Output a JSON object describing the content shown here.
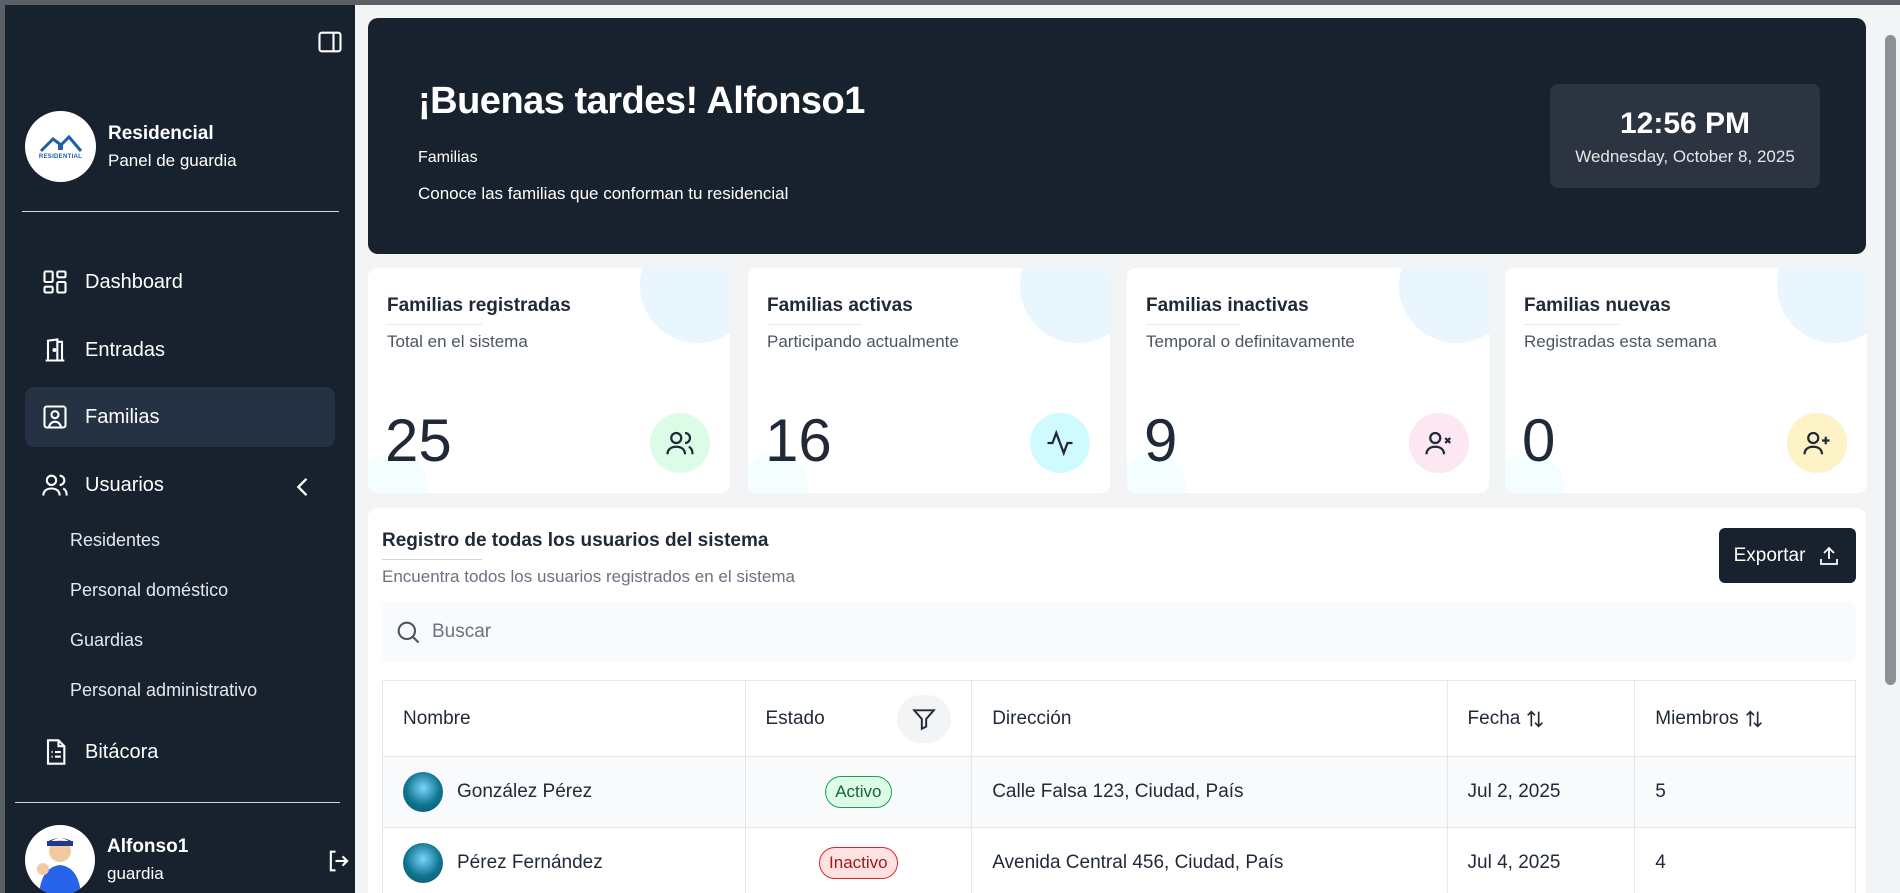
{
  "sidebar": {
    "brand": {
      "title": "Residencial",
      "subtitle": "Panel de guardia",
      "logo_text": "RESIDENTIAL"
    },
    "nav": [
      {
        "label": "Dashboard",
        "icon": "dashboard-icon"
      },
      {
        "label": "Entradas",
        "icon": "door-icon"
      },
      {
        "label": "Familias",
        "icon": "contact-card-icon",
        "active": true
      },
      {
        "label": "Usuarios",
        "icon": "users-icon"
      }
    ],
    "sub_items": [
      "Residentes",
      "Personal doméstico",
      "Guardias",
      "Personal administrativo"
    ],
    "bitacora": "Bitácora",
    "user": {
      "name": "Alfonso1",
      "role": "guardia"
    }
  },
  "hero": {
    "title": "¡Buenas tardes! Alfonso1",
    "subtitle": "Familias",
    "description": "Conoce las familias que conforman tu residencial",
    "time": "12:56 PM",
    "date": "Wednesday, October 8, 2025"
  },
  "stats": [
    {
      "title": "Familias registradas",
      "desc": "Total en el sistema",
      "value": "25",
      "color": "#dcfce7",
      "blob": "#dbeafe"
    },
    {
      "title": "Familias activas",
      "desc": "Participando actualmente",
      "value": "16",
      "color": "#cffafe",
      "blob": "#dbeafe"
    },
    {
      "title": "Familias inactivas",
      "desc": "Temporal o definitavamente",
      "value": "9",
      "color": "#fce7f3",
      "blob": "#dbeafe"
    },
    {
      "title": "Familias nuevas",
      "desc": "Registradas esta semana",
      "value": "0",
      "color": "#fef3c7",
      "blob": "#dbeafe"
    }
  ],
  "table_card": {
    "title": "Registro de todas los usuarios del sistema",
    "description": "Encuentra todos los usuarios registrados en el sistema",
    "export_label": "Exportar",
    "search_placeholder": "Buscar",
    "columns": [
      "Nombre",
      "Estado",
      "Dirección",
      "Fecha",
      "Miembros"
    ],
    "rows": [
      {
        "name": "González Pérez",
        "status": "Activo",
        "address": "Calle Falsa 123, Ciudad, País",
        "date": "Jul 2, 2025",
        "members": "5"
      },
      {
        "name": "Pérez Fernández",
        "status": "Inactivo",
        "address": "Avenida Central 456, Ciudad, País",
        "date": "Jul 4, 2025",
        "members": "4"
      }
    ]
  }
}
